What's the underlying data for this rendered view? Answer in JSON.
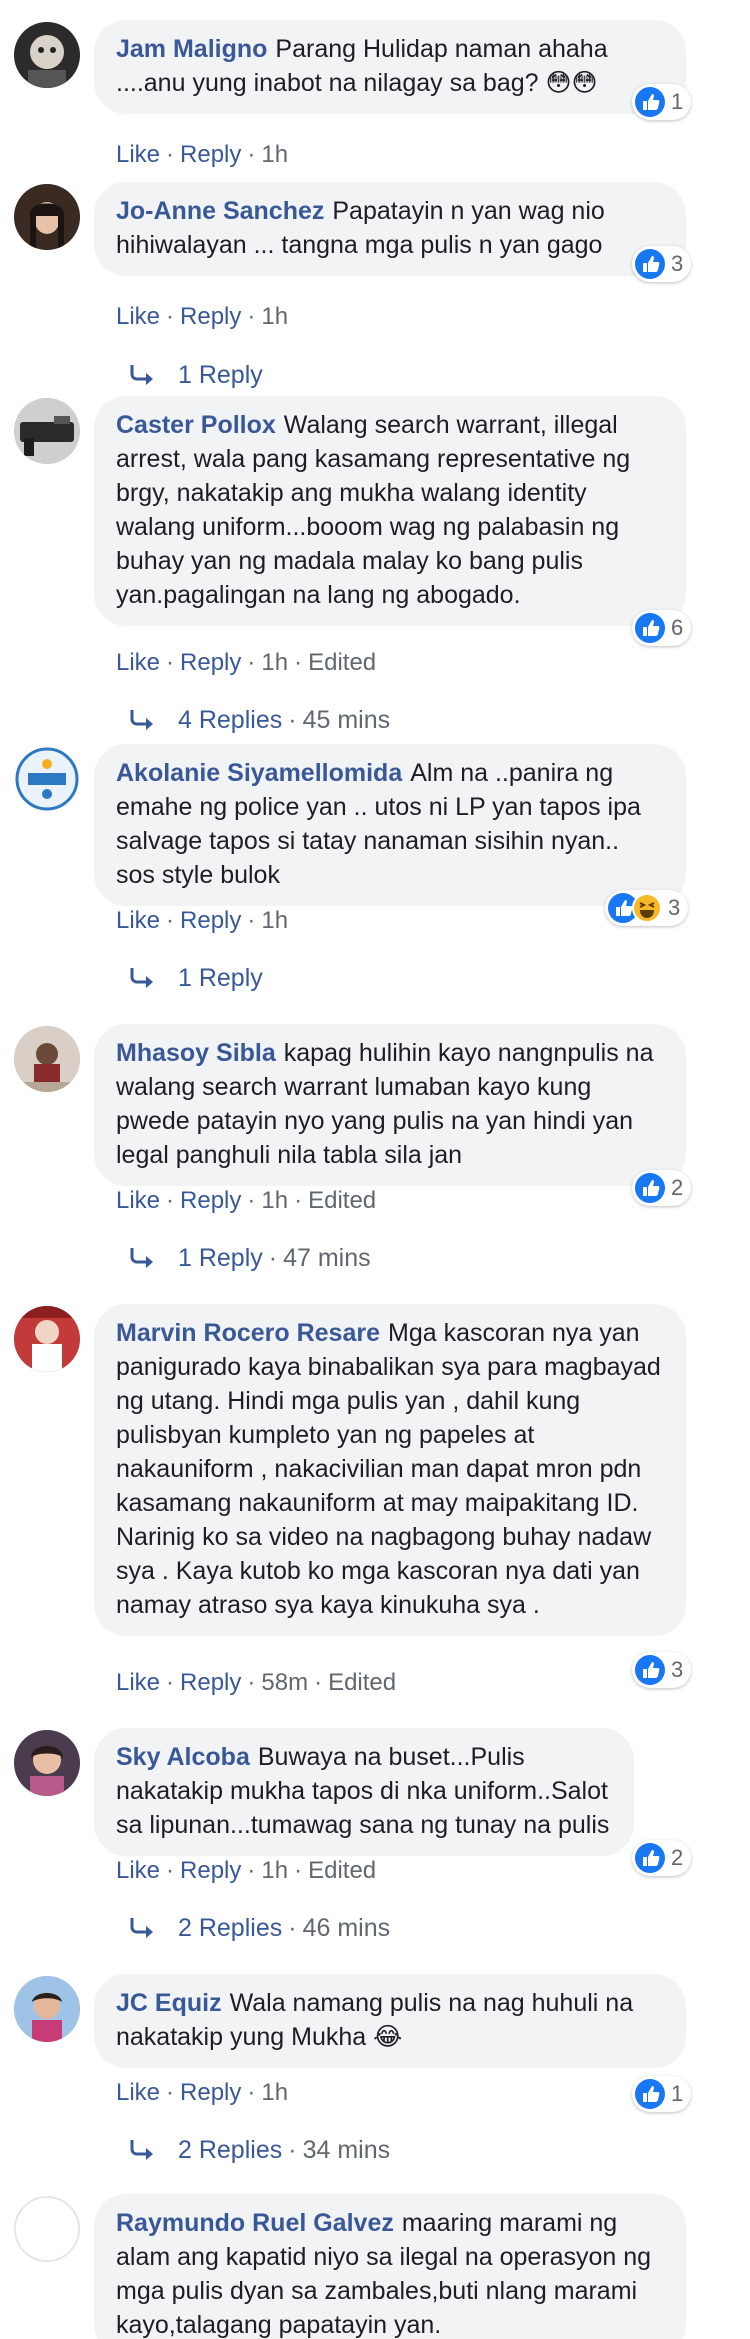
{
  "colors": {
    "link": "#385898",
    "meta": "#606770",
    "bubble": "#f2f3f5",
    "like_blue": "#1877f2",
    "haha_yellow": "#f7b928"
  },
  "comments": [
    {
      "author": "Jam Maligno",
      "text": "Parang Hulidap naman ahaha ....anu yung inabot na nilagay sa bag? 😳😳",
      "reactions": [
        "like-icon"
      ],
      "reaction_count": "1",
      "like": "Like",
      "reply": "Reply",
      "time": "1h",
      "edited": ""
    },
    {
      "author": "Jo-Anne Sanchez",
      "text": "Papatayin n yan wag nio hihiwalayan ... tangna mga pulis n yan gago",
      "reactions": [
        "like-icon"
      ],
      "reaction_count": "3",
      "like": "Like",
      "reply": "Reply",
      "time": "1h",
      "edited": "",
      "replies_label": "1 Reply",
      "replies_time": ""
    },
    {
      "author": "Caster Pollox",
      "text": "Walang search warrant, illegal arrest, wala pang kasamang representative ng brgy, nakatakip ang mukha walang identity walang uniform...booom wag ng palabasin ng buhay yan ng madala malay ko bang pulis yan.pagalingan na lang ng abogado.",
      "reactions": [
        "like-icon"
      ],
      "reaction_count": "6",
      "like": "Like",
      "reply": "Reply",
      "time": "1h",
      "edited": "Edited",
      "replies_label": "4 Replies",
      "replies_time": "45 mins"
    },
    {
      "author": "Akolanie Siyamellomida",
      "text": "Alm na ..panira ng emahe ng police yan .. utos ni LP yan tapos ipa salvage tapos si tatay nanaman sisihin nyan.. sos style bulok",
      "reactions": [
        "like-icon",
        "haha-icon"
      ],
      "reaction_count": "3",
      "like": "Like",
      "reply": "Reply",
      "time": "1h",
      "edited": "",
      "replies_label": "1 Reply",
      "replies_time": ""
    },
    {
      "author": "Mhasoy Sibla",
      "text": "kapag hulihin kayo nangnpulis na walang search warrant lumaban kayo kung pwede patayin nyo yang pulis na yan hindi yan legal panghuli nila tabla sila jan",
      "reactions": [
        "like-icon"
      ],
      "reaction_count": "2",
      "like": "Like",
      "reply": "Reply",
      "time": "1h",
      "edited": "Edited",
      "replies_label": "1 Reply",
      "replies_time": "47 mins"
    },
    {
      "author": "Marvin Rocero Resare",
      "text": "Mga kascoran nya yan panigurado kaya binabalikan sya para magbayad ng utang. Hindi mga pulis yan , dahil kung pulisbyan kumpleto yan ng papeles at nakauniform , nakacivilian man dapat mron pdn kasamang nakauniform at may maipakitang ID. Narinig ko sa video na nagbagong buhay nadaw sya . Kaya kutob ko mga kascoran nya dati yan namay atraso sya kaya kinukuha sya .",
      "reactions": [
        "like-icon"
      ],
      "reaction_count": "3",
      "like": "Like",
      "reply": "Reply",
      "time": "58m",
      "edited": "Edited"
    },
    {
      "author": "Sky Alcoba",
      "text": "Buwaya na buset...Pulis nakatakip mukha tapos di nka uniform..Salot sa lipunan...tumawag sana ng tunay na pulis",
      "reactions": [
        "like-icon"
      ],
      "reaction_count": "2",
      "like": "Like",
      "reply": "Reply",
      "time": "1h",
      "edited": "Edited",
      "replies_label": "2 Replies",
      "replies_time": "46 mins"
    },
    {
      "author": "JC Equiz",
      "text": "Wala namang pulis na nag huhuli na nakatakip yung Mukha 😂",
      "reactions": [
        "like-icon"
      ],
      "reaction_count": "1",
      "like": "Like",
      "reply": "Reply",
      "time": "1h",
      "edited": "",
      "replies_label": "2 Replies",
      "replies_time": "34 mins"
    },
    {
      "author": "Raymundo Ruel Galvez",
      "text": "maaring marami ng alam ang kapatid niyo sa ilegal na operasyon ng mga pulis dyan sa zambales,buti nlang marami kayo,talagang papatayin yan."
    }
  ]
}
